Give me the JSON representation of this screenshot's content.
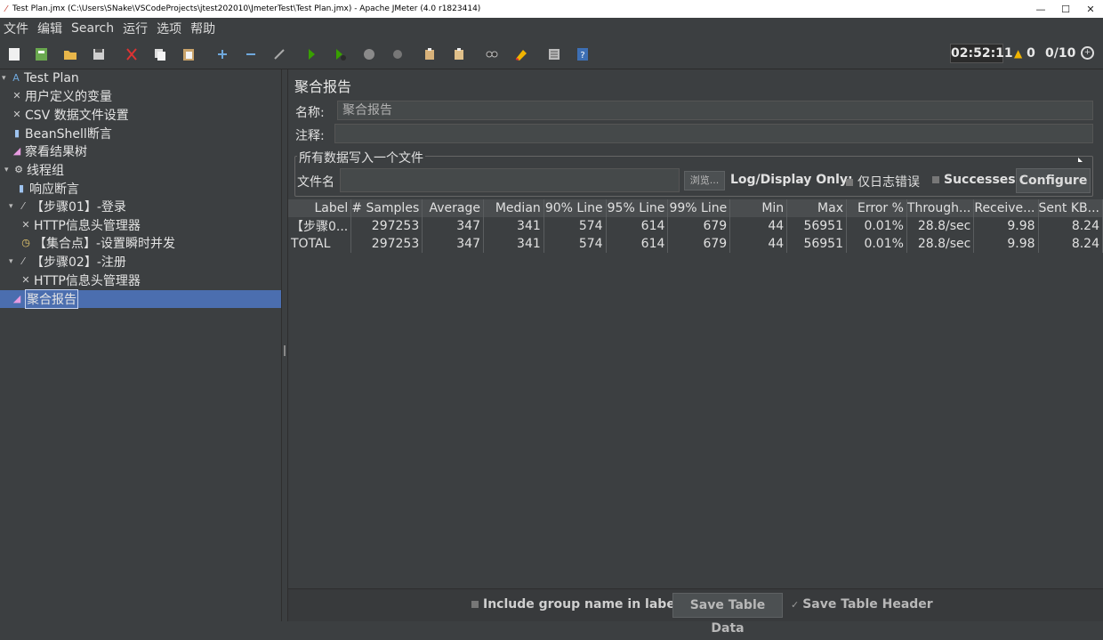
{
  "window": {
    "title": "Test Plan.jmx (C:\\Users\\SNake\\VSCodeProjects\\jtest202010\\JmeterTest\\Test Plan.jmx) - Apache JMeter (4.0 r1823414)"
  },
  "menu": [
    "文件",
    "编辑",
    "Search",
    "运行",
    "选项",
    "帮助"
  ],
  "status": {
    "timer": "02:52:11",
    "warnings": "0",
    "threads": "0/10"
  },
  "toolbar_icons": [
    "new-icon",
    "templates-icon",
    "open-icon",
    "save-icon",
    "cut-icon",
    "copy-icon",
    "paste-icon",
    "expand-icon",
    "collapse-icon",
    "toggle-icon",
    "start-icon",
    "start-no-pause-icon",
    "stop-icon",
    "shutdown-icon",
    "clear-icon",
    "clear-all-icon",
    "search-icon",
    "reset-search-icon",
    "function-helper-icon",
    "help-icon"
  ],
  "tree": [
    {
      "label": "Test Plan",
      "icon": "testplan-icon",
      "depth": 0,
      "arrow": "▾"
    },
    {
      "label": "用户定义的变量",
      "icon": "config-icon",
      "depth": 1,
      "arrow": ""
    },
    {
      "label": "CSV 数据文件设置",
      "icon": "config-icon",
      "depth": 1,
      "arrow": ""
    },
    {
      "label": "BeanShell断言",
      "icon": "assertion-icon",
      "depth": 1,
      "arrow": ""
    },
    {
      "label": "察看结果树",
      "icon": "listener-icon",
      "depth": 1,
      "arrow": ""
    },
    {
      "label": "线程组",
      "icon": "threadgroup-icon",
      "depth": 1,
      "arrow": "▾"
    },
    {
      "label": "响应断言",
      "icon": "assertion-icon",
      "depth": 2,
      "arrow": ""
    },
    {
      "label": "【步骤01】-登录",
      "icon": "transaction-icon",
      "depth": 2,
      "arrow": "▾"
    },
    {
      "label": "HTTP信息头管理器",
      "icon": "config-icon",
      "depth": 3,
      "arrow": ""
    },
    {
      "label": "【集合点】-设置瞬时并发",
      "icon": "timer-icon",
      "depth": 3,
      "arrow": ""
    },
    {
      "label": "【步骤02】-注册",
      "icon": "transaction-icon",
      "depth": 2,
      "arrow": "▾"
    },
    {
      "label": "HTTP信息头管理器",
      "icon": "config-icon",
      "depth": 3,
      "arrow": ""
    },
    {
      "label": "聚合报告",
      "icon": "listener-icon",
      "depth": 2,
      "arrow": "",
      "selected": true
    }
  ],
  "panel": {
    "title": "聚合报告",
    "name_label": "名称:",
    "name_value": "聚合报告",
    "comment_label": "注释:",
    "comment_value": "",
    "file_group_title": "所有数据写入一个文件",
    "filename_label": "文件名",
    "filename_value": "",
    "browse_label": "浏览...",
    "log_display_label": "Log/Display Only:",
    "errors_only_label": "仅日志错误",
    "successes_label": "Successes",
    "configure_label": "Configure"
  },
  "table": {
    "columns": [
      "Label",
      "# Samples",
      "Average",
      "Median",
      "90% Line",
      "95% Line",
      "99% Line",
      "Min",
      "Max",
      "Error %",
      "Through...",
      "Receive...",
      "Sent KB..."
    ],
    "rows": [
      [
        "【步骤0...",
        "297253",
        "347",
        "341",
        "574",
        "614",
        "679",
        "44",
        "56951",
        "0.01%",
        "28.8/sec",
        "9.98",
        "8.24"
      ],
      [
        "TOTAL",
        "297253",
        "347",
        "341",
        "574",
        "614",
        "679",
        "44",
        "56951",
        "0.01%",
        "28.8/sec",
        "9.98",
        "8.24"
      ]
    ]
  },
  "bottom": {
    "include_group_label": "Include group name in label?",
    "save_table_data_label": "Save Table Data",
    "save_table_header_label": "Save Table Header"
  }
}
